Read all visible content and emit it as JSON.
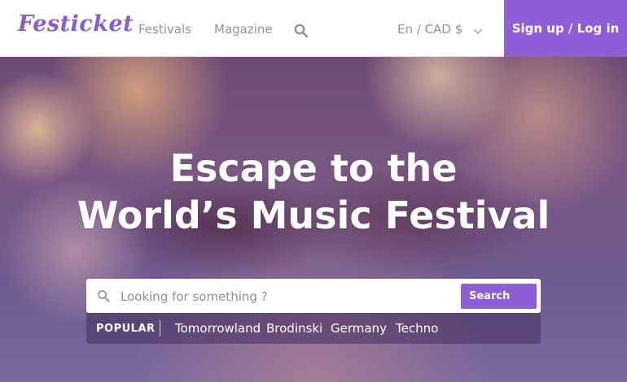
{
  "header": {
    "logo": "Festicket",
    "nav": {
      "festivals": "Festivals",
      "magazine": "Magazine"
    },
    "language_currency": "En / CAD $",
    "signup_login": "Sign up / Log in"
  },
  "hero": {
    "title_line1": "Escape to the",
    "title_line2": "World’s Music Festival",
    "search": {
      "placeholder": "Looking for something ?",
      "button_label": "Search"
    },
    "popular": {
      "label": "POPULAR",
      "tags": [
        "Tomorrowland",
        "Brodinski",
        "Germany",
        "Techno"
      ]
    }
  },
  "colors": {
    "brand_purple": "#8e5ed7",
    "nav_text": "#8a94a6"
  },
  "icons": [
    "search-icon",
    "chevron-down-icon"
  ]
}
